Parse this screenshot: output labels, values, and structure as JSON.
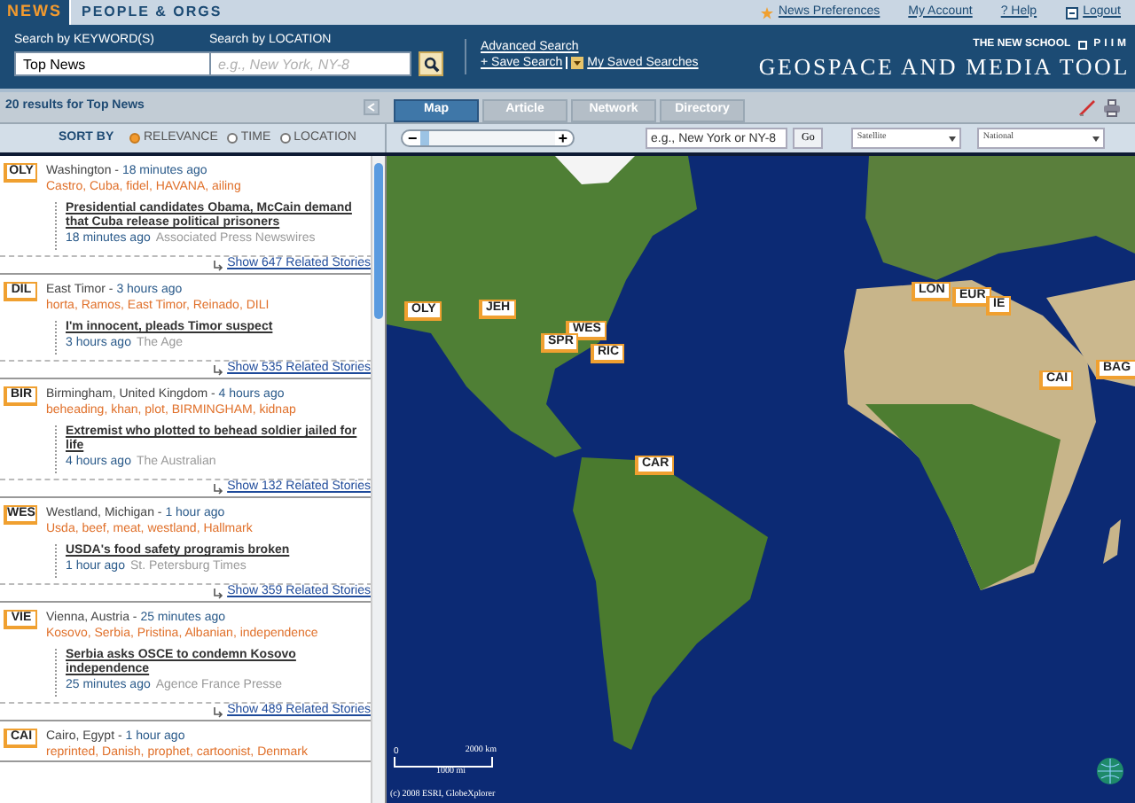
{
  "top_tabs": [
    {
      "label": "NEWS",
      "selected": true
    },
    {
      "label": "PEOPLE & ORGS",
      "selected": false
    }
  ],
  "top_links": [
    "News Preferences",
    "My Account",
    "? Help",
    "Logout"
  ],
  "search": {
    "keyword_label": "Search by KEYWORD(S)",
    "keyword_value": "Top News",
    "location_label": "Search by LOCATION",
    "location_placeholder": "e.g., New York, NY-8"
  },
  "search_links": [
    "Advanced Search",
    "+ Save Search",
    "My Saved Searches"
  ],
  "brand": {
    "school": "THE NEW SCHOOL",
    "lab": "PIIM",
    "title": "GEOSPACE AND MEDIA TOOL"
  },
  "results_summary": "20 results for Top News",
  "view_tabs": [
    {
      "label": "Map",
      "selected": true
    },
    {
      "label": "Article",
      "selected": false
    },
    {
      "label": "Network",
      "selected": false
    },
    {
      "label": "Directory",
      "selected": false
    }
  ],
  "sort": {
    "label": "SORT BY",
    "options": [
      {
        "label": "RELEVANCE",
        "selected": true
      },
      {
        "label": "TIME",
        "selected": false
      },
      {
        "label": "LOCATION",
        "selected": false
      }
    ]
  },
  "map_toolbar": {
    "zoom_out": "−",
    "zoom_in": "+",
    "level": 0.06,
    "location_placeholder": "e.g., New York or NY-8",
    "go": "Go",
    "map_type": "Satellite",
    "scope": "National"
  },
  "stories": [
    {
      "code": "OLY",
      "place": "Washington -",
      "time": "18 minutes ago",
      "tags": "Castro, Cuba, fidel, HAVANA, ailing",
      "headline": "Presidential candidates Obama, McCain demand that Cuba release political prisoners",
      "age": "18 minutes ago",
      "source": "Associated Press Newswires",
      "related": "Show 647 Related Stories"
    },
    {
      "code": "DIL",
      "place": "East Timor -",
      "time": "3 hours ago",
      "tags": "horta, Ramos, East Timor, Reinado, DILI",
      "headline": "I'm innocent, pleads Timor suspect",
      "age": "3 hours ago",
      "source": "The Age",
      "related": "Show 535 Related Stories"
    },
    {
      "code": "BIR",
      "place": "Birmingham, United Kingdom -",
      "time": "4 hours ago",
      "tags": "beheading, khan, plot, BIRMINGHAM, kidnap",
      "headline": "Extremist who plotted to behead soldier jailed for life",
      "age": "4 hours ago",
      "source": "The Australian",
      "related": "Show 132 Related Stories"
    },
    {
      "code": "WES",
      "place": "Westland, Michigan -",
      "time": "1 hour ago",
      "tags": "Usda, beef, meat, westland, Hallmark",
      "headline": "USDA's food safety programis broken",
      "age": "1 hour ago",
      "source": "St. Petersburg Times",
      "related": "Show 359 Related Stories"
    },
    {
      "code": "VIE",
      "place": "Vienna, Austria -",
      "time": "25 minutes ago",
      "tags": "Kosovo, Serbia, Pristina, Albanian, independence",
      "headline": "Serbia asks OSCE to condemn Kosovo independence",
      "age": "25 minutes ago",
      "source": "Agence France Presse",
      "related": "Show 489 Related Stories"
    },
    {
      "code": "CAI",
      "place": "Cairo, Egypt -",
      "time": "1 hour ago",
      "tags": "reprinted, Danish, prophet, cartoonist, Denmark"
    }
  ],
  "map": {
    "markers": [
      "OLY",
      "JEH",
      "WES",
      "SPR",
      "RIC",
      "CAR",
      "LON",
      "EUR",
      "IE",
      "CAI",
      "BAG"
    ],
    "scale_zero": "0",
    "scale_km": "2000 km",
    "scale_mi": "1000 mi",
    "copyright": "(c) 2008 ESRI, GlobeXplorer"
  }
}
